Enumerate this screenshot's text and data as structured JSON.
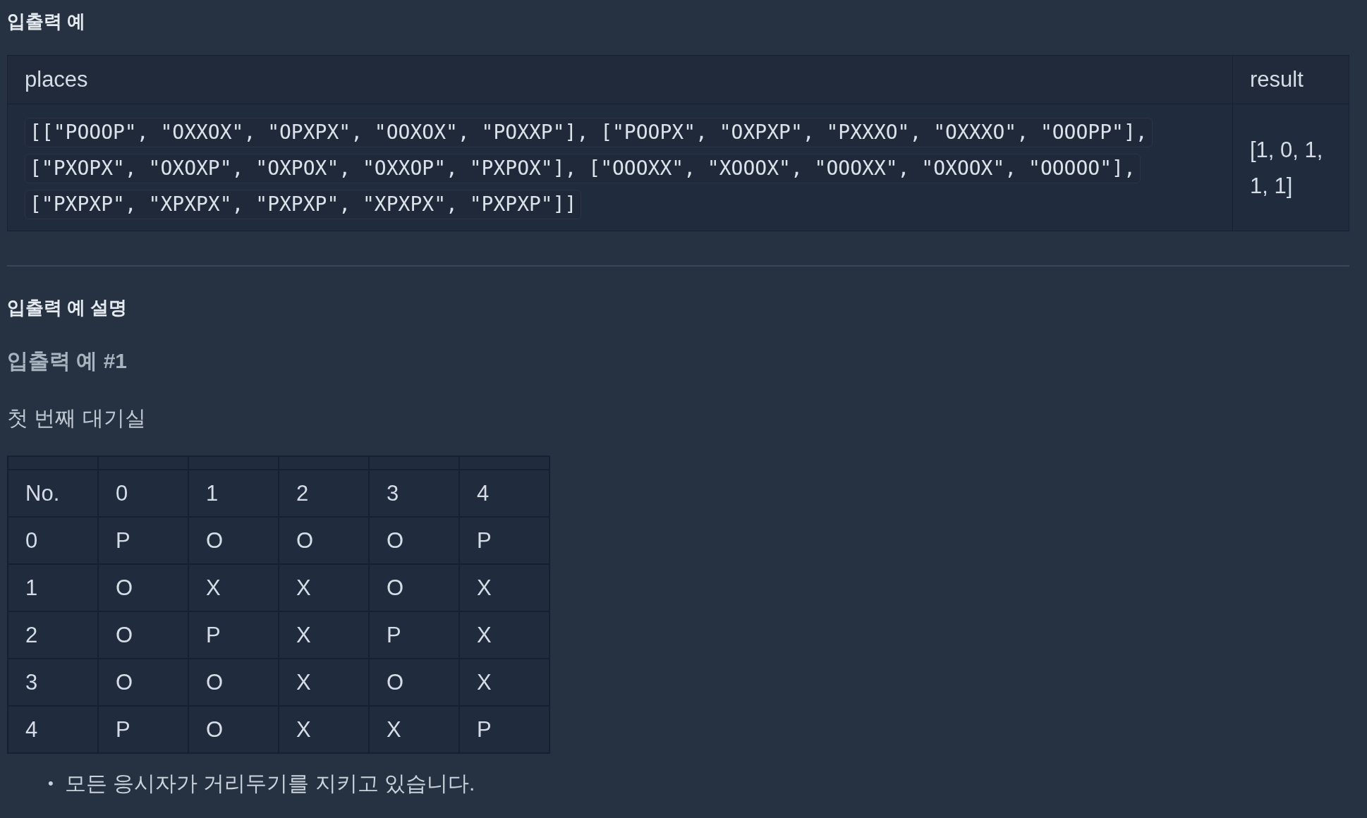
{
  "io_example": {
    "heading": "입출력 예",
    "columns": [
      "places",
      "result"
    ],
    "rows": [
      {
        "places": [
          "[[\"POOOP\", \"OXXOX\", \"OPXPX\", \"OOXOX\", \"POXXP\"], [\"POOPX\", \"OXPXP\", \"PXXXO\", \"OXXXO\", \"OOOPP\"],",
          "[\"PXOPX\", \"OXOXP\", \"OXPOX\", \"OXXOP\", \"PXPOX\"], [\"OOOXX\", \"XOOOX\", \"OOOXX\", \"OXOOX\", \"OOOOO\"],",
          "[\"PXPXP\", \"XPXPX\", \"PXPXP\", \"XPXPX\", \"PXPXP\"]]"
        ],
        "result": "[1, 0, 1, 1, 1]"
      }
    ]
  },
  "explanation": {
    "heading": "입출력 예 설명",
    "subheading": "입출력 예 #1",
    "caption": "첫 번째 대기실",
    "grid": [
      [
        "No.",
        "0",
        "1",
        "2",
        "3",
        "4"
      ],
      [
        "0",
        "P",
        "O",
        "O",
        "O",
        "P"
      ],
      [
        "1",
        "O",
        "X",
        "X",
        "O",
        "X"
      ],
      [
        "2",
        "O",
        "P",
        "X",
        "P",
        "X"
      ],
      [
        "3",
        "O",
        "O",
        "X",
        "O",
        "X"
      ],
      [
        "4",
        "P",
        "O",
        "X",
        "X",
        "P"
      ]
    ],
    "bullets": [
      {
        "marker": "•",
        "text": "모든 응시자가 거리두기를 지키고 있습니다."
      }
    ]
  }
}
